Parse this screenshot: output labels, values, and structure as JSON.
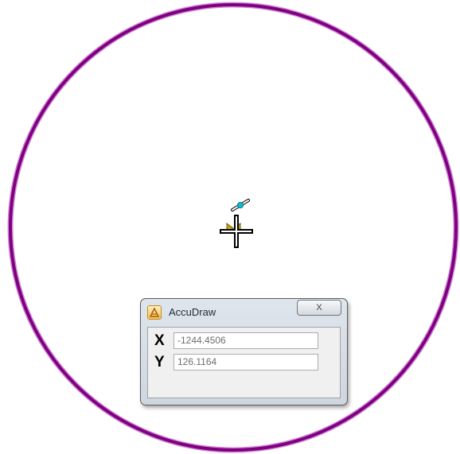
{
  "accudraw": {
    "title": "AccuDraw",
    "close_label": "X",
    "x_label": "X",
    "x_value": "-1244.4506",
    "y_label": "Y",
    "y_value": "126.1164"
  },
  "canvas": {
    "circle_color": "#800080",
    "circle_halo_color": "#d08cd8",
    "cursor_color": "#000000",
    "tentative_point_color": "#00c4d6",
    "snap_marker_color": "#c2a21a"
  },
  "icons": {
    "accudraw": "accudraw-icon",
    "close": "close-icon",
    "crosshair": "crosshair-cursor-icon",
    "snap": "snap-marker-icon",
    "tentative": "tentative-point-icon"
  }
}
